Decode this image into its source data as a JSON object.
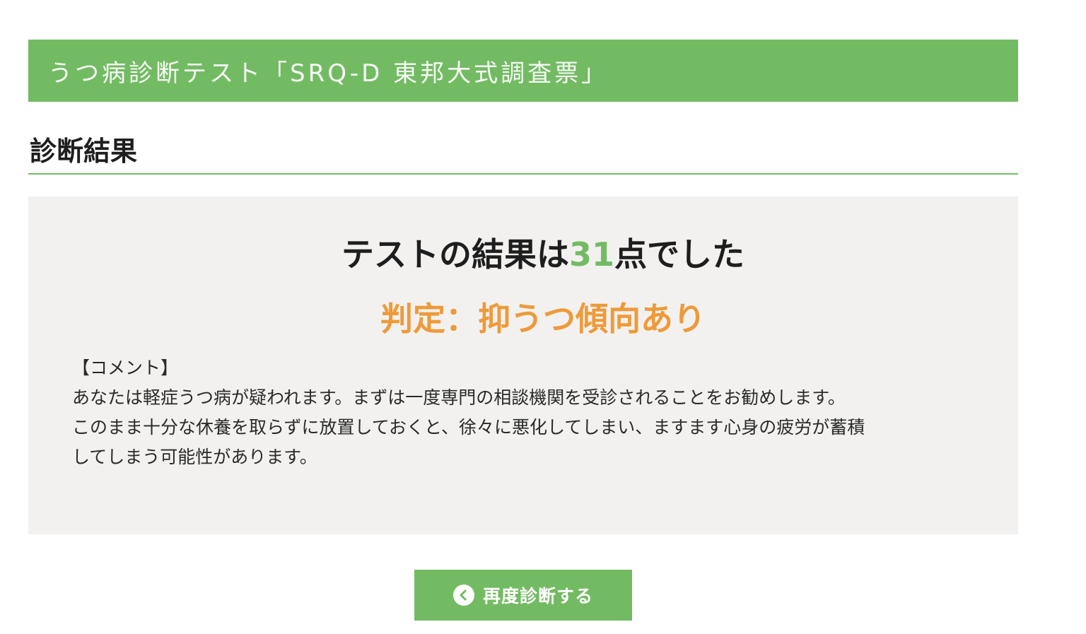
{
  "header": {
    "title": "うつ病診断テスト「SRQ-D 東邦大式調査票」"
  },
  "section": {
    "title": "診断結果"
  },
  "result": {
    "score_prefix": "テストの結果は",
    "score": "31",
    "score_suffix": "点でした",
    "verdict": "判定：抑うつ傾向あり",
    "comment_heading": "【コメント】",
    "comment_lines": [
      "あなたは軽症うつ病が疑われます。まずは一度専門の相談機関を受診されることをお勧めします。",
      "このまま十分な休養を取らずに放置しておくと、徐々に悪化してしまい、ますます心身の疲労が蓄積",
      "してしまう可能性があります。"
    ]
  },
  "actions": {
    "retry_label": "再度診断する",
    "retry_icon": "chevron-left-circle-icon"
  },
  "colors": {
    "brand_green": "#73bb63",
    "verdict_orange": "#ee9a3a",
    "panel_bg": "#f2f1ef"
  }
}
